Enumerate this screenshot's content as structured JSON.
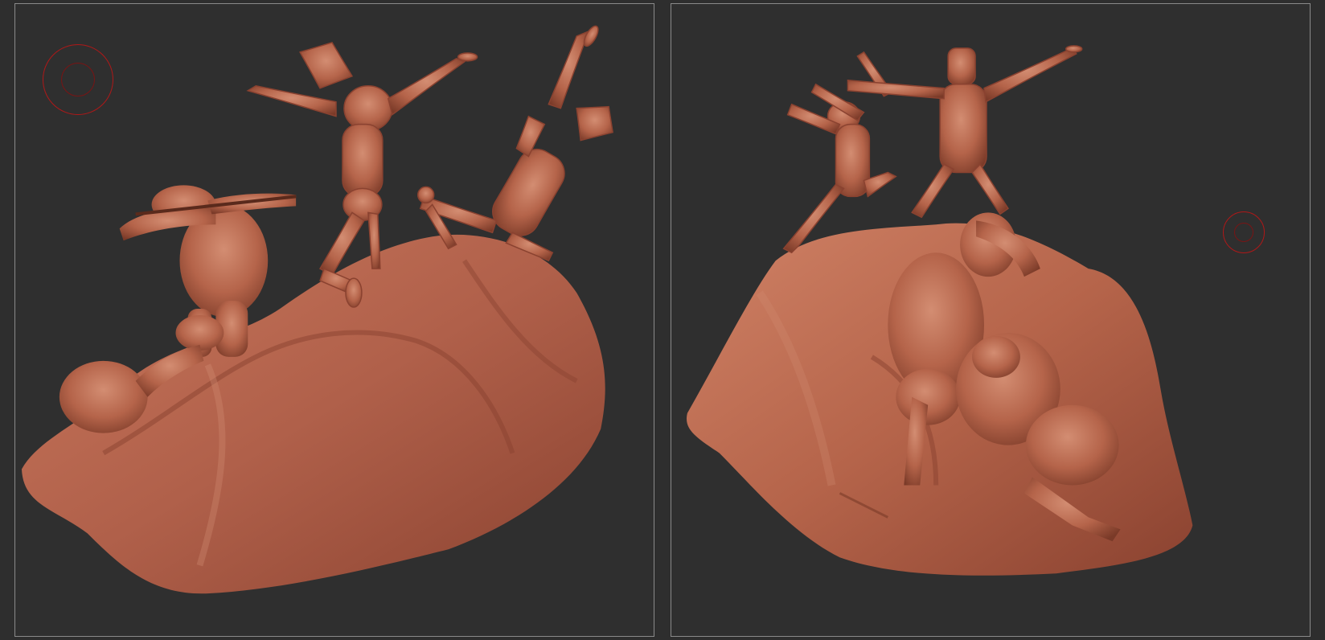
{
  "app": {
    "viewports": [
      {
        "id": "left",
        "view": "front-left"
      },
      {
        "id": "right",
        "view": "rear-right"
      }
    ]
  },
  "colors": {
    "background": "#2e2e2e",
    "viewport_border": "#8a8a8a",
    "clay": "#b5644a",
    "clay_light": "#d08a70",
    "clay_dark": "#7a3a28",
    "brush_cursor": "#b01818"
  },
  "icons": [
    "brush-cursor-icon"
  ]
}
